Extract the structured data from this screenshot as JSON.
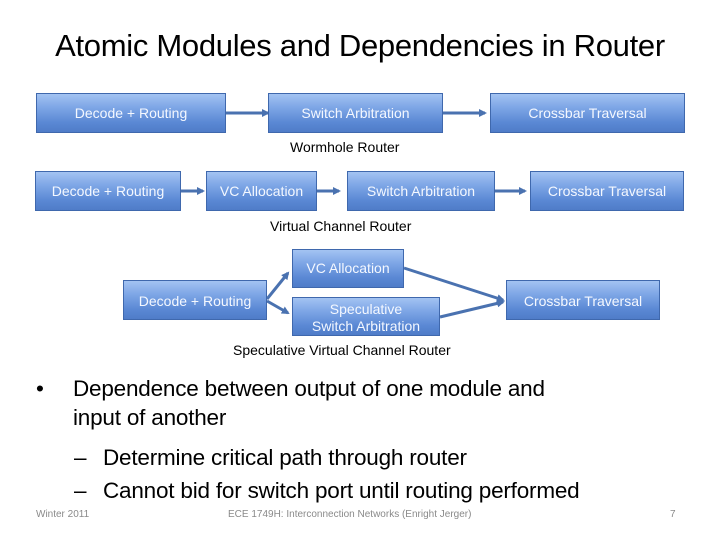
{
  "slide": {
    "title": "Atomic Modules and Dependencies in Router",
    "diagrams": {
      "wormhole": {
        "caption": "Wormhole Router",
        "modules": [
          "Decode + Routing",
          "Switch Arbitration",
          "Crossbar Traversal"
        ]
      },
      "virtual_channel": {
        "caption": "Virtual Channel Router",
        "modules": [
          "Decode + Routing",
          "VC Allocation",
          "Switch Arbitration",
          "Crossbar Traversal"
        ]
      },
      "speculative": {
        "caption": "Speculative Virtual Channel Router",
        "modules": {
          "decode": "Decode + Routing",
          "vc_alloc": "VC Allocation",
          "spec_sa_line1": "Speculative",
          "spec_sa_line2": "Switch Arbitration",
          "crossbar": "Crossbar Traversal"
        }
      }
    },
    "bullets": [
      {
        "text": "Dependence between output of one module and input of another",
        "line1": "Dependence between output of one module and",
        "line2": "input of another",
        "sub": [
          "Determine critical path through router",
          "Cannot bid for switch port until routing performed"
        ]
      }
    ],
    "bullet_glyph": "•",
    "sub_bullet_glyph": "–",
    "footer": {
      "left": "Winter 2011",
      "center": "ECE 1749H: Interconnection Networks (Enright Jerger)",
      "page": "7"
    },
    "colors": {
      "box_fill_top": "#a3c3f2",
      "box_fill_bottom": "#4f7cc8",
      "box_border": "#3f68ad",
      "arrow": "#4a72b0",
      "footer_text": "#8a8a8a"
    }
  }
}
